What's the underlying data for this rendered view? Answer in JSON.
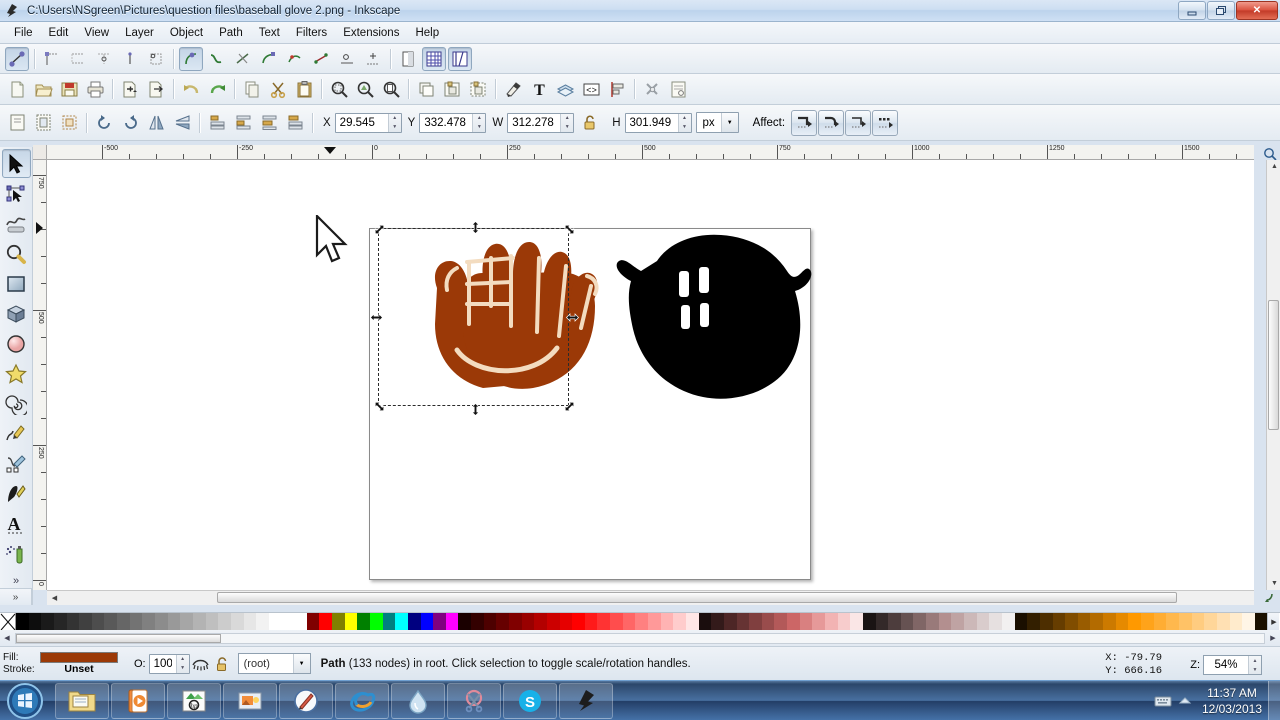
{
  "window": {
    "title": "C:\\Users\\NSgreen\\Pictures\\question files\\baseball glove 2.png - Inkscape",
    "app_icon": "inkscape-icon",
    "minimize_label": "–",
    "restore_label": "❐",
    "close_label": "✕"
  },
  "menu": {
    "items": [
      {
        "label": "File"
      },
      {
        "label": "Edit"
      },
      {
        "label": "View"
      },
      {
        "label": "Layer"
      },
      {
        "label": "Object"
      },
      {
        "label": "Path"
      },
      {
        "label": "Text"
      },
      {
        "label": "Filters"
      },
      {
        "label": "Extensions"
      },
      {
        "label": "Help"
      }
    ]
  },
  "snap_toolbar": {
    "items": [
      {
        "name": "enable-snapping",
        "pressed": true
      },
      {
        "name": "snap-bounding-boxes"
      },
      {
        "name": "snap-bbox-edges"
      },
      {
        "name": "snap-bbox-corners"
      },
      {
        "name": "snap-bbox-edge-midpoints"
      },
      {
        "name": "snap-bbox-centers"
      },
      {
        "name": "snap-nodes-paths",
        "pressed": true
      },
      {
        "name": "snap-paths"
      },
      {
        "name": "snap-path-intersections"
      },
      {
        "name": "snap-cusp-nodes"
      },
      {
        "name": "snap-smooth-nodes"
      },
      {
        "name": "snap-line-midpoints"
      },
      {
        "name": "snap-object-centers"
      },
      {
        "name": "snap-page-border"
      },
      {
        "name": "snap-grids",
        "pressed": true
      },
      {
        "name": "snap-guides",
        "pressed": true
      }
    ]
  },
  "command_toolbar": {
    "items": [
      {
        "name": "new-document-icon"
      },
      {
        "name": "open-document-icon"
      },
      {
        "name": "save-document-icon"
      },
      {
        "name": "print-document-icon"
      },
      {
        "name": "import-icon"
      },
      {
        "name": "export-icon"
      },
      {
        "name": "undo-icon"
      },
      {
        "name": "redo-icon"
      },
      {
        "name": "copy-icon"
      },
      {
        "name": "cut-icon"
      },
      {
        "name": "paste-icon"
      },
      {
        "name": "zoom-selection-icon"
      },
      {
        "name": "zoom-drawing-icon"
      },
      {
        "name": "zoom-page-icon"
      },
      {
        "name": "duplicate-icon"
      },
      {
        "name": "group-icon"
      },
      {
        "name": "ungroup-icon"
      },
      {
        "name": "fill-stroke-dialog-icon"
      },
      {
        "name": "text-properties-icon"
      },
      {
        "name": "layers-dialog-icon"
      },
      {
        "name": "xml-editor-icon"
      },
      {
        "name": "align-distribute-icon"
      },
      {
        "name": "preferences-icon"
      },
      {
        "name": "document-properties-icon"
      }
    ]
  },
  "select_toolbar": {
    "buttons": [
      {
        "name": "select-all-icon"
      },
      {
        "name": "select-all-layers-icon"
      },
      {
        "name": "deselect-icon"
      },
      {
        "name": "rotate-ccw-icon"
      },
      {
        "name": "rotate-cw-icon"
      },
      {
        "name": "flip-horizontal-icon"
      },
      {
        "name": "flip-vertical-icon"
      },
      {
        "name": "lower-to-bottom-icon"
      },
      {
        "name": "lower-icon"
      },
      {
        "name": "raise-icon"
      },
      {
        "name": "raise-to-top-icon"
      }
    ],
    "x_label": "X",
    "x_value": "29.545",
    "y_label": "Y",
    "y_value": "332.478",
    "w_label": "W",
    "w_value": "312.278",
    "h_label": "H",
    "h_value": "301.949",
    "lock_name": "lock-aspect-ratio-icon",
    "units": "px",
    "affect_label": "Affect:",
    "affect_buttons": [
      {
        "name": "affect-stroke-width"
      },
      {
        "name": "affect-rounded-corners"
      },
      {
        "name": "affect-gradients"
      },
      {
        "name": "affect-patterns"
      }
    ]
  },
  "toolbox": {
    "tools": [
      {
        "name": "selector-tool",
        "active": true
      },
      {
        "name": "node-tool",
        "active": false
      },
      {
        "name": "tweak-tool",
        "active": false
      },
      {
        "name": "zoom-tool",
        "active": false
      },
      {
        "name": "rectangle-tool",
        "active": false
      },
      {
        "name": "box3d-tool",
        "active": false
      },
      {
        "name": "ellipse-tool",
        "active": false
      },
      {
        "name": "star-tool",
        "active": false
      },
      {
        "name": "spiral-tool",
        "active": false
      },
      {
        "name": "pencil-tool",
        "active": false
      },
      {
        "name": "bezier-tool",
        "active": false
      },
      {
        "name": "calligraphy-tool",
        "active": false
      },
      {
        "name": "text-tool",
        "active": false
      },
      {
        "name": "spray-tool",
        "active": false
      }
    ],
    "overflow_label": "»"
  },
  "rulers": {
    "unit": "px",
    "horizontal_labels": [
      "-500",
      "-250",
      "0",
      "250",
      "500",
      "750",
      "1000",
      "1250",
      "1500"
    ],
    "vertical_labels": [
      "750",
      "500",
      "250",
      "0"
    ]
  },
  "canvas": {
    "page_background": "#ffffff",
    "objects": [
      {
        "name": "baseball-glove-brown",
        "fill": "#9b3907",
        "selected": true
      },
      {
        "name": "baseball-glove-black",
        "fill": "#000000",
        "selected": false
      }
    ],
    "selection_handles": "scale-arrows",
    "cursor": "arrow-pointer"
  },
  "palette": {
    "none_label": "X",
    "left_arrow": "◀",
    "right_arrow": "▶",
    "colors": [
      "#000000",
      "#0d0d0d",
      "#1a1a1a",
      "#262626",
      "#333333",
      "#404040",
      "#4d4d4d",
      "#595959",
      "#666666",
      "#737373",
      "#808080",
      "#8c8c8c",
      "#999999",
      "#a6a6a6",
      "#b3b3b3",
      "#bfbfbf",
      "#cccccc",
      "#d9d9d9",
      "#e6e6e6",
      "#f2f2f2",
      "#ffffff",
      "#ffffff",
      "#ffffff",
      "#800000",
      "#ff0000",
      "#808000",
      "#ffff00",
      "#008000",
      "#00ff00",
      "#008080",
      "#00ffff",
      "#000080",
      "#0000ff",
      "#800080",
      "#ff00ff",
      "#1a0000",
      "#330000",
      "#4d0000",
      "#660000",
      "#800000",
      "#990000",
      "#b30000",
      "#cc0000",
      "#e60000",
      "#ff0000",
      "#ff1a1a",
      "#ff3333",
      "#ff4d4d",
      "#ff6666",
      "#ff8080",
      "#ff9999",
      "#ffb3b3",
      "#ffcccc",
      "#ffe6e6",
      "#1a0d0d",
      "#331a1a",
      "#4d2626",
      "#663333",
      "#803f3f",
      "#994c4c",
      "#b35959",
      "#cc6666",
      "#d98080",
      "#e69999",
      "#f2b3b3",
      "#f7cccc",
      "#fae6e6",
      "#1a1414",
      "#332929",
      "#4d3d3d",
      "#665252",
      "#806666",
      "#997a7a",
      "#b38f8f",
      "#bfa3a3",
      "#ccb8b8",
      "#d9cccc",
      "#e6e0e0",
      "#f2f0f0",
      "#1a0f00",
      "#331f00",
      "#4d2e00",
      "#663d00",
      "#804d00",
      "#995c00",
      "#b36b00",
      "#cc7a00",
      "#e68a00",
      "#ff9900",
      "#ffa31a",
      "#ffad33",
      "#ffb84d",
      "#ffc266",
      "#ffcc80",
      "#ffd699",
      "#ffe0b3",
      "#ffebcc",
      "#fff5e6",
      "#1a1000"
    ]
  },
  "statusbar": {
    "fill_label": "Fill:",
    "stroke_label": "Stroke:",
    "fill_color": "#9b3907",
    "stroke_value": "Unset",
    "opacity_label": "O:",
    "opacity_value": "100",
    "layer_visibility_icon": "eye-closed-icon",
    "layer_lock_icon": "unlock-icon",
    "layer_name": "(root)",
    "message_bold": "Path",
    "message_rest": " (133 nodes) in root. Click selection to toggle scale/rotation handles.",
    "coord_x_label": "X:",
    "coord_x_value": "-79.79",
    "coord_y_label": "Y:",
    "coord_y_value": "666.16",
    "zoom_label": "Z:",
    "zoom_value": "54%"
  },
  "taskbar": {
    "start_name": "windows-start-orb",
    "apps": [
      {
        "name": "taskbar-file-explorer"
      },
      {
        "name": "taskbar-media-player"
      },
      {
        "name": "taskbar-hp-app"
      },
      {
        "name": "taskbar-photo-viewer"
      },
      {
        "name": "taskbar-paint-app"
      },
      {
        "name": "taskbar-internet-explorer"
      },
      {
        "name": "taskbar-water-app"
      },
      {
        "name": "taskbar-snipping-tool"
      },
      {
        "name": "taskbar-skype"
      },
      {
        "name": "taskbar-inkscape"
      }
    ],
    "tray_icons": [
      {
        "name": "tray-keyboard-icon"
      },
      {
        "name": "tray-show-hidden-icon"
      }
    ],
    "clock_time": "11:37 AM",
    "clock_date": "12/03/2013"
  }
}
